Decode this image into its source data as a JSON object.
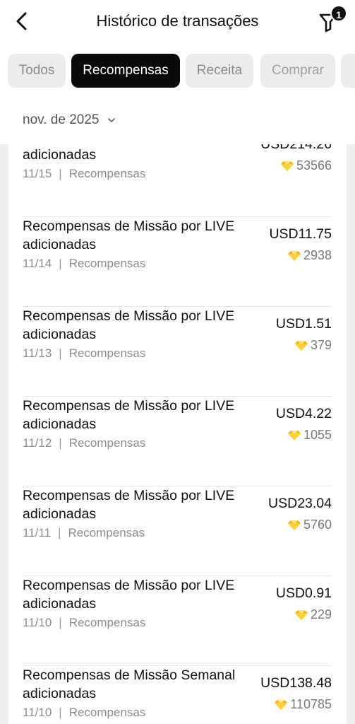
{
  "header": {
    "title": "Histórico de transações",
    "filter_badge": "1"
  },
  "tabs": [
    {
      "label": "Todos",
      "active": false
    },
    {
      "label": "Recompensas",
      "active": true
    },
    {
      "label": "Receita",
      "active": false
    },
    {
      "label": "Comprar",
      "active": false
    }
  ],
  "month_selector": {
    "label": "nov. de 2025"
  },
  "transactions": [
    {
      "title": "Recompensas de Missão por LIVE adicionadas",
      "title_visible": "adicionadas",
      "date": "11/15",
      "category": "Recompensas",
      "usd": "USD214.26",
      "gems": "53566"
    },
    {
      "title": "Recompensas de Missão por LIVE adicionadas",
      "date": "11/14",
      "category": "Recompensas",
      "usd": "USD11.75",
      "gems": "2938"
    },
    {
      "title": "Recompensas de Missão por LIVE adicionadas",
      "date": "11/13",
      "category": "Recompensas",
      "usd": "USD1.51",
      "gems": "379"
    },
    {
      "title": "Recompensas de Missão por LIVE adicionadas",
      "date": "11/12",
      "category": "Recompensas",
      "usd": "USD4.22",
      "gems": "1055"
    },
    {
      "title": "Recompensas de Missão por LIVE adicionadas",
      "date": "11/11",
      "category": "Recompensas",
      "usd": "USD23.04",
      "gems": "5760"
    },
    {
      "title": "Recompensas de Missão por LIVE adicionadas",
      "date": "11/10",
      "category": "Recompensas",
      "usd": "USD0.91",
      "gems": "229"
    },
    {
      "title": "Recompensas de Missão Semanal adicionadas",
      "date": "11/10",
      "category": "Recompensas",
      "usd": "USD138.48",
      "gems": "110785"
    }
  ],
  "icons": {
    "back": "chevron-left-icon",
    "filter": "filter-icon",
    "gem": "diamond-icon",
    "month_toggle": "chevron-down-icon"
  },
  "colors": {
    "active_tab": "#0a0a0a",
    "gem": "#f5b400"
  }
}
